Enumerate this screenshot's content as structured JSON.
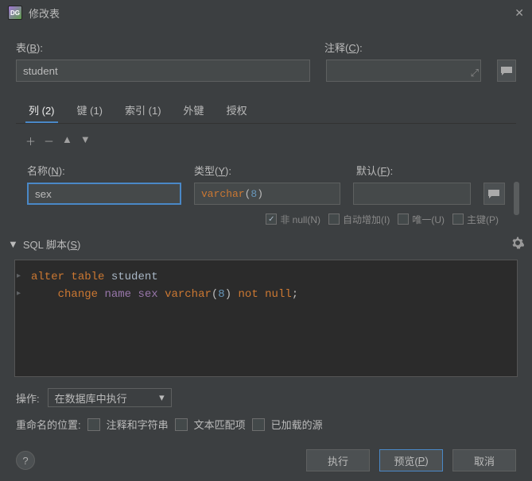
{
  "window": {
    "title": "修改表"
  },
  "labels": {
    "table": "表(",
    "table_key": "B",
    "table_suffix": "):",
    "comment": "注释(",
    "comment_key": "C",
    "comment_suffix": "):"
  },
  "table_name": "student",
  "tabs": [
    {
      "label": "列 (2)",
      "active": true
    },
    {
      "label": "键 (1)"
    },
    {
      "label": "索引 (1)"
    },
    {
      "label": "外键"
    },
    {
      "label": "授权"
    }
  ],
  "column_fields": {
    "name_label": "名称(",
    "name_key": "N",
    "name_suffix": "):",
    "type_label": "类型(",
    "type_key": "Y",
    "type_suffix": "):",
    "default_label": "默认(",
    "default_key": "F",
    "default_suffix": "):",
    "name_value": "sex",
    "type_kw": "varchar",
    "type_paren_open": "(",
    "type_num": "8",
    "type_paren_close": ")"
  },
  "checkboxes": {
    "notnull": "非 null(N)",
    "autoinc": "自动增加(I)",
    "unique": "唯一(U)",
    "pk": "主键(P)"
  },
  "sql": {
    "header": "SQL 脚本(",
    "header_key": "S",
    "header_suffix": ")",
    "tokens": {
      "alter": "alter",
      "table": "table",
      "tname": "student",
      "change": "change",
      "old": "name",
      "new": "sex",
      "type": "varchar",
      "open": "(",
      "num": "8",
      "close": ")",
      "not": "not",
      "null": "null",
      "semi": ";"
    }
  },
  "operation": {
    "label": "操作:",
    "selected": "在数据库中执行"
  },
  "rename": {
    "label": "重命名的位置:",
    "opts": [
      "注释和字符串",
      "文本匹配项",
      "已加载的源"
    ]
  },
  "footer": {
    "execute": "执行",
    "preview": "预览(",
    "preview_key": "P",
    "preview_suffix": ")",
    "cancel": "取消"
  }
}
